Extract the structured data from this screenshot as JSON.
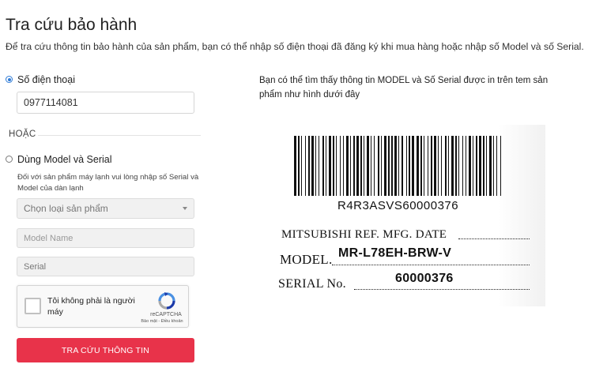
{
  "page": {
    "title": "Tra cứu bảo hành",
    "description": "Để tra cứu thông tin bảo hành của sản phẩm, bạn có thể nhập số điện thoại đã đăng ký khi mua hàng hoặc nhập số Model và số Serial."
  },
  "phone_option": {
    "label": "Số điện thoại",
    "selected": true,
    "value": "0977114081"
  },
  "divider_label": "HOẶC",
  "model_option": {
    "label": "Dùng Model và Serial",
    "selected": false,
    "note": "Đối với sản phẩm máy lạnh vui lòng nhập số Serial và Model của dàn lạnh",
    "product_type_select": "Chọn loại sản phẩm",
    "model_placeholder": "Model Name",
    "serial_placeholder": "Serial"
  },
  "captcha": {
    "text": "Tôi không phải là người máy",
    "brand": "reCAPTCHA",
    "links": "Bảo mật - Điều khoản"
  },
  "submit_label": "TRA CỨU THÔNG TIN",
  "hint_text": "Bạn có thể tìm thấy thông tin MODEL và Số Serial được in trên tem sản phẩm như hình dưới đây",
  "label_image": {
    "barcode_text": "R4R3ASVS60000376",
    "ref_line": "MITSUBISHI REF.  MFG. DATE",
    "model_label": "MODEL.",
    "model_value": "MR-L78EH-BRW-V",
    "serial_label": "SERIAL No.",
    "serial_value": "60000376"
  },
  "colors": {
    "accent": "#2f7bd6",
    "button": "#e8334a"
  }
}
